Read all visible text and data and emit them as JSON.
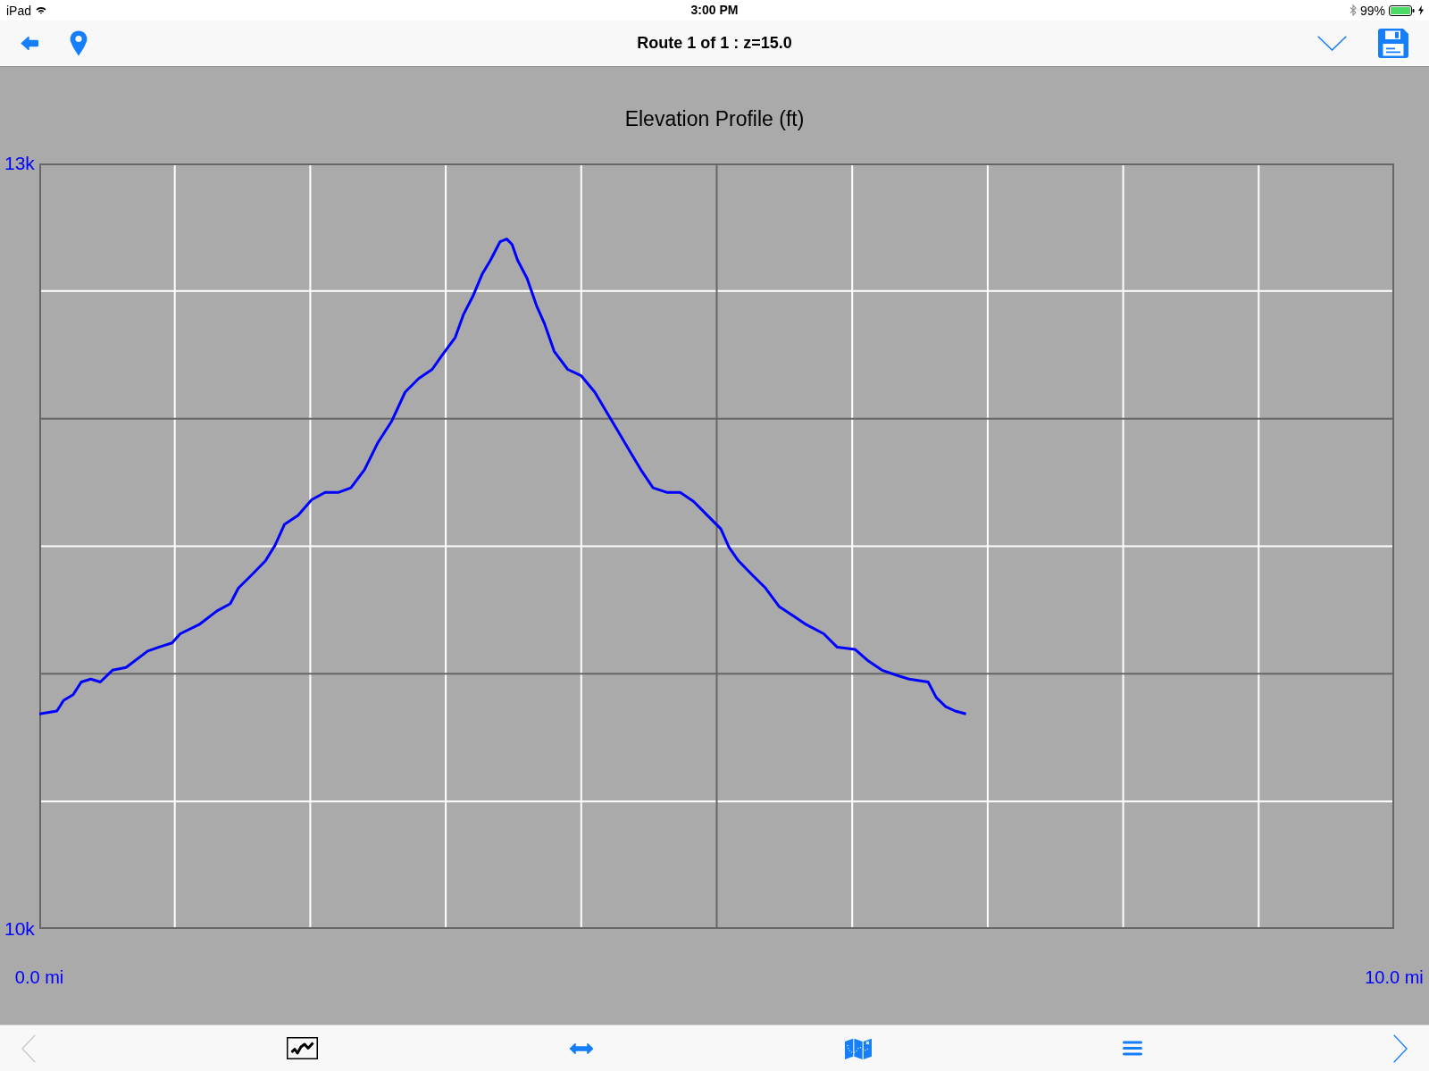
{
  "status_bar": {
    "device": "iPad",
    "time": "3:00 PM",
    "battery": "99%"
  },
  "nav_bar": {
    "title": "Route 1 of 1 : z=15.0"
  },
  "chart": {
    "chart_data": {
      "type": "line",
      "title": "Elevation Profile (ft)",
      "x": [
        0,
        0.13,
        0.18,
        0.25,
        0.31,
        0.38,
        0.45,
        0.54,
        0.64,
        0.8,
        0.88,
        0.98,
        1.04,
        1.18,
        1.31,
        1.41,
        1.47,
        1.57,
        1.67,
        1.74,
        1.81,
        1.91,
        2.01,
        2.11,
        2.21,
        2.3,
        2.4,
        2.5,
        2.6,
        2.7,
        2.8,
        2.9,
        2.97,
        3.07,
        3.13,
        3.2,
        3.27,
        3.33,
        3.4,
        3.45,
        3.49,
        3.53,
        3.6,
        3.67,
        3.73,
        3.8,
        3.9,
        4.0,
        4.1,
        4.18,
        4.26,
        4.36,
        4.44,
        4.53,
        4.63,
        4.73,
        4.83,
        4.93,
        5.03,
        5.09,
        5.16,
        5.26,
        5.36,
        5.46,
        5.56,
        5.66,
        5.79,
        5.89,
        6.02,
        6.12,
        6.22,
        6.32,
        6.42,
        6.56,
        6.62,
        6.69,
        6.76,
        6.84
      ],
      "series": [
        {
          "color": "#0000ff",
          "values": [
            10843,
            10854,
            10896,
            10918,
            10968,
            10979,
            10968,
            11014,
            11025,
            11089,
            11104,
            11121,
            11157,
            11193,
            11246,
            11275,
            11336,
            11389,
            11443,
            11504,
            11586,
            11621,
            11682,
            11711,
            11711,
            11729,
            11800,
            11907,
            11989,
            12104,
            12157,
            12193,
            12246,
            12318,
            12407,
            12479,
            12568,
            12621,
            12693,
            12704,
            12682,
            12621,
            12550,
            12443,
            12371,
            12264,
            12193,
            12168,
            12104,
            12032,
            11961,
            11871,
            11800,
            11729,
            11711,
            11711,
            11675,
            11621,
            11568,
            11496,
            11443,
            11389,
            11336,
            11264,
            11229,
            11193,
            11157,
            11104,
            11096,
            11050,
            11014,
            10996,
            10979,
            10968,
            10907,
            10871,
            10854,
            10843
          ]
        }
      ],
      "xlim": [
        0,
        10
      ],
      "ylim": [
        10000,
        13000
      ],
      "xticks": [
        {
          "value": 0,
          "label": "0.0 mi"
        },
        {
          "value": 10,
          "label": "10.0 mi"
        }
      ],
      "yticks": [
        {
          "value": 13000,
          "label": "13k"
        },
        {
          "value": 10000,
          "label": "10k"
        }
      ]
    }
  },
  "toolbar": {
    "items": [
      {
        "kind": "previous",
        "selected": false,
        "disabled": true
      },
      {
        "kind": "chart",
        "selected": true,
        "disabled": false
      },
      {
        "kind": "resize",
        "selected": false,
        "disabled": false
      },
      {
        "kind": "map",
        "selected": false,
        "disabled": false
      },
      {
        "kind": "menu",
        "selected": false,
        "disabled": false
      },
      {
        "kind": "next",
        "selected": false,
        "disabled": false
      }
    ]
  }
}
